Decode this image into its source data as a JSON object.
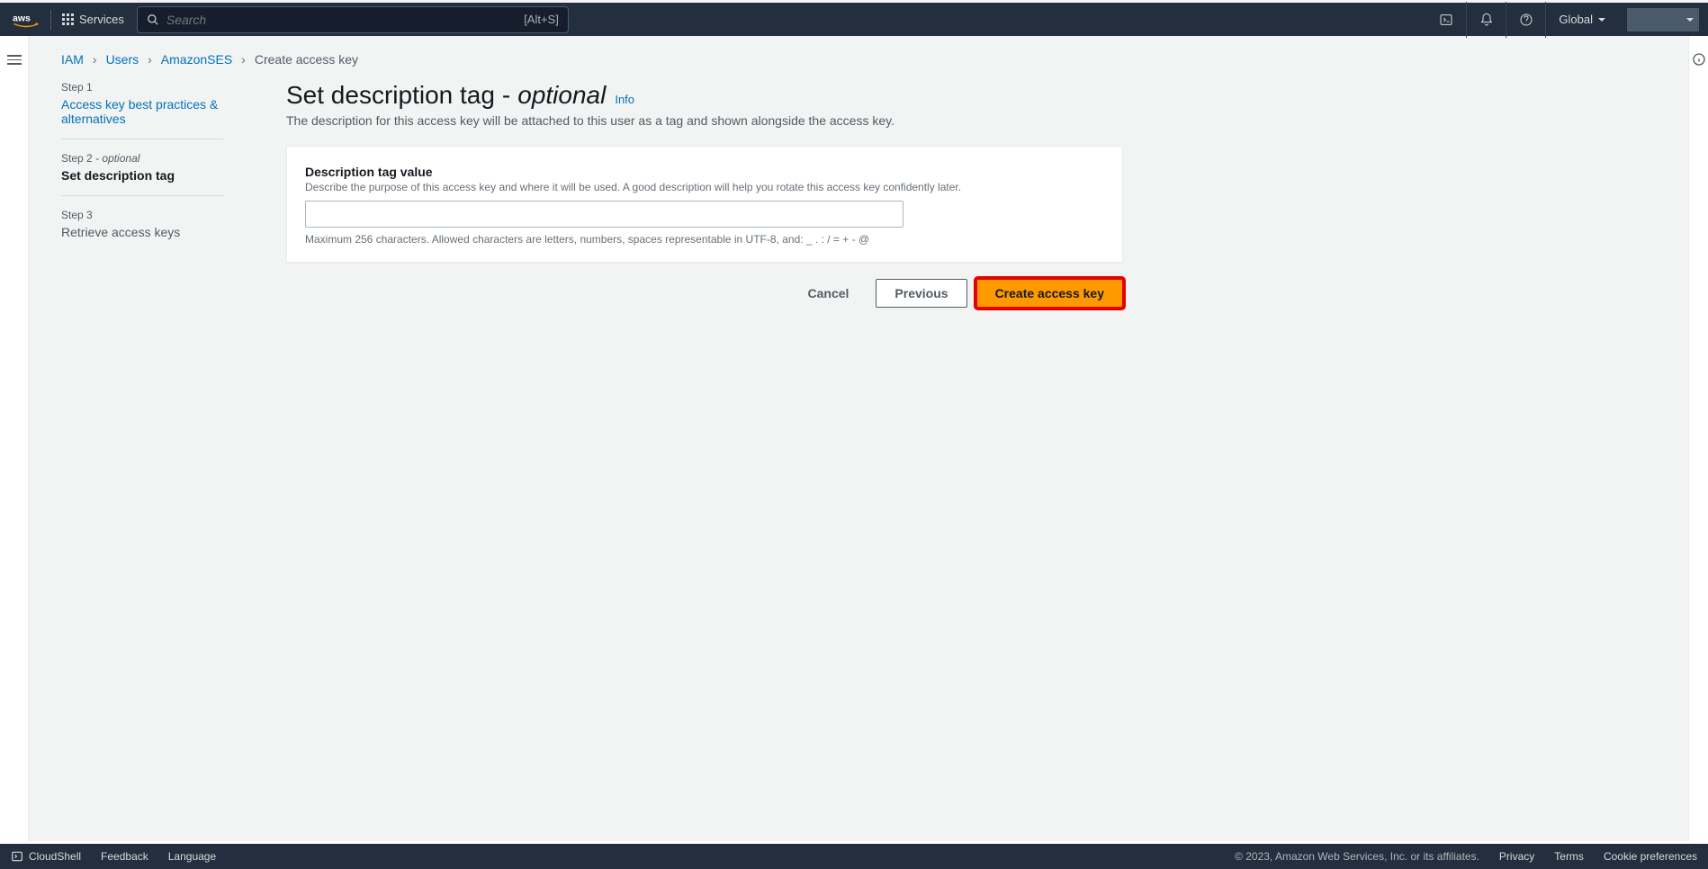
{
  "nav": {
    "services_label": "Services",
    "search_placeholder": "Search",
    "search_shortcut": "[Alt+S]",
    "region": "Global"
  },
  "breadcrumb": {
    "items": [
      "IAM",
      "Users",
      "AmazonSES"
    ],
    "current": "Create access key"
  },
  "wizard": {
    "step1_label": "Step 1",
    "step1_title": "Access key best practices & alternatives",
    "step2_label": "Step 2",
    "step2_opt": "- optional",
    "step2_title": "Set description tag",
    "step3_label": "Step 3",
    "step3_title": "Retrieve access keys"
  },
  "page": {
    "title_main": "Set description tag",
    "title_dash": "-",
    "title_opt": "optional",
    "info": "Info",
    "description": "The description for this access key will be attached to this user as a tag and shown alongside the access key."
  },
  "form": {
    "field_label": "Description tag value",
    "field_help": "Describe the purpose of this access key and where it will be used. A good description will help you rotate this access key confidently later.",
    "field_value": "",
    "field_constraint": "Maximum 256 characters. Allowed characters are letters, numbers, spaces representable in UTF-8, and: _ . : / = + - @"
  },
  "actions": {
    "cancel": "Cancel",
    "previous": "Previous",
    "create": "Create access key"
  },
  "footer": {
    "cloudshell": "CloudShell",
    "feedback": "Feedback",
    "language": "Language",
    "copyright": "© 2023, Amazon Web Services, Inc. or its affiliates.",
    "privacy": "Privacy",
    "terms": "Terms",
    "cookies": "Cookie preferences"
  }
}
